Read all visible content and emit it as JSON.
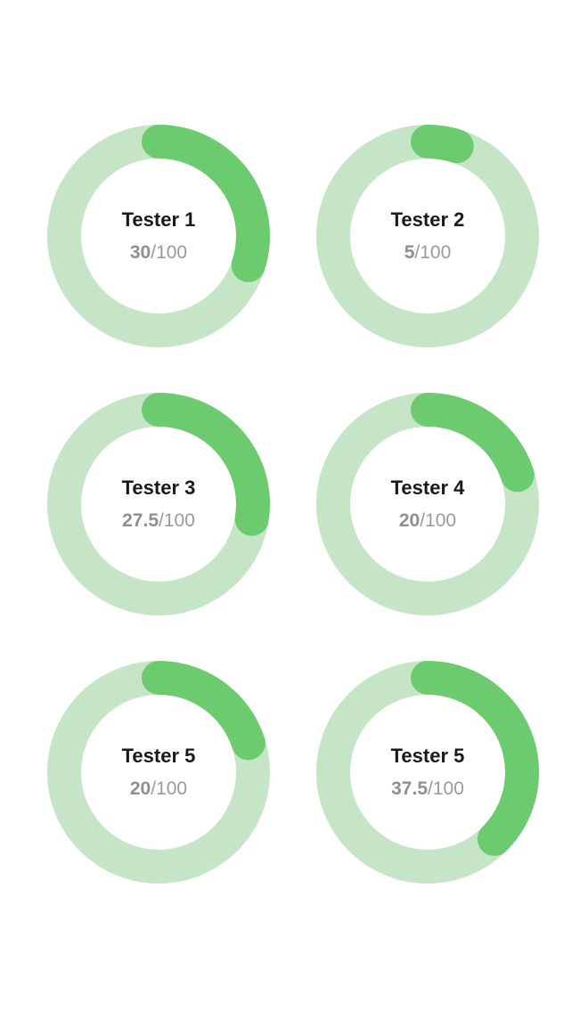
{
  "colors": {
    "track": "#c5e5c6",
    "progress": "#6ccb6e",
    "name_text": "#1a1a1a",
    "score_text": "#9a9a9a"
  },
  "testers": [
    {
      "name": "Tester 1",
      "score_label": "30",
      "max_label": "/100",
      "progress": 0.3
    },
    {
      "name": "Tester 2",
      "score_label": "5",
      "max_label": "/100",
      "progress": 0.05
    },
    {
      "name": "Tester 3",
      "score_label": "27.5",
      "max_label": "/100",
      "progress": 0.275
    },
    {
      "name": "Tester 4",
      "score_label": "20",
      "max_label": "/100",
      "progress": 0.2
    },
    {
      "name": "Tester 5",
      "score_label": "20",
      "max_label": "/100",
      "progress": 0.2
    },
    {
      "name": "Tester 5",
      "score_label": "37.5",
      "max_label": "/100",
      "progress": 0.375
    }
  ]
}
